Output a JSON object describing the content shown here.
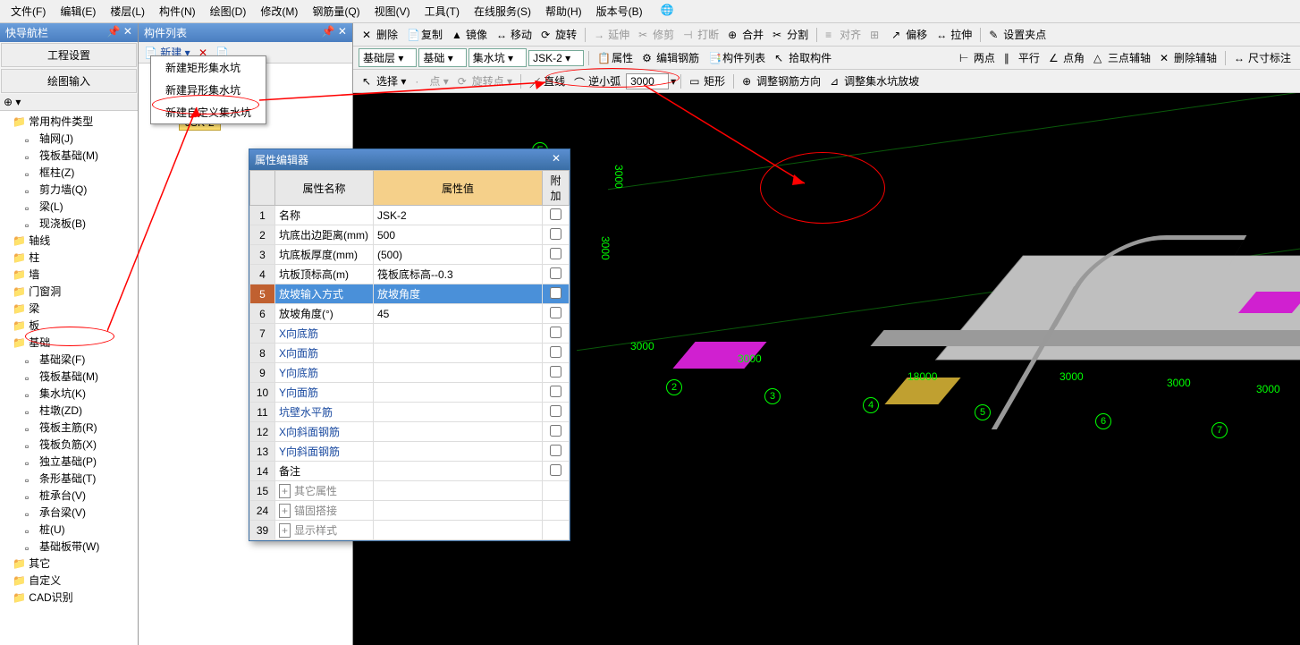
{
  "menu": [
    "文件(F)",
    "编辑(E)",
    "楼层(L)",
    "构件(N)",
    "绘图(D)",
    "修改(M)",
    "钢筋量(Q)",
    "视图(V)",
    "工具(T)",
    "在线服务(S)",
    "帮助(H)",
    "版本号(B)"
  ],
  "nav": {
    "title": "快导航栏",
    "tabs": [
      "工程设置",
      "绘图输入"
    ],
    "toolbar_glyph": "⊕ ▾",
    "tree": [
      {
        "lvl": 1,
        "label": "常用构件类型",
        "folder": true
      },
      {
        "lvl": 2,
        "label": "轴网(J)"
      },
      {
        "lvl": 2,
        "label": "筏板基础(M)"
      },
      {
        "lvl": 2,
        "label": "框柱(Z)"
      },
      {
        "lvl": 2,
        "label": "剪力墙(Q)"
      },
      {
        "lvl": 2,
        "label": "梁(L)"
      },
      {
        "lvl": 2,
        "label": "现浇板(B)"
      },
      {
        "lvl": 1,
        "label": "轴线",
        "folder": true
      },
      {
        "lvl": 1,
        "label": "柱",
        "folder": true
      },
      {
        "lvl": 1,
        "label": "墙",
        "folder": true
      },
      {
        "lvl": 1,
        "label": "门窗洞",
        "folder": true
      },
      {
        "lvl": 1,
        "label": "梁",
        "folder": true
      },
      {
        "lvl": 1,
        "label": "板",
        "folder": true
      },
      {
        "lvl": 1,
        "label": "基础",
        "folder": true
      },
      {
        "lvl": 2,
        "label": "基础梁(F)"
      },
      {
        "lvl": 2,
        "label": "筏板基础(M)"
      },
      {
        "lvl": 2,
        "label": "集水坑(K)",
        "circled": true
      },
      {
        "lvl": 2,
        "label": "柱墩(ZD)"
      },
      {
        "lvl": 2,
        "label": "筏板主筋(R)"
      },
      {
        "lvl": 2,
        "label": "筏板负筋(X)"
      },
      {
        "lvl": 2,
        "label": "独立基础(P)"
      },
      {
        "lvl": 2,
        "label": "条形基础(T)"
      },
      {
        "lvl": 2,
        "label": "桩承台(V)"
      },
      {
        "lvl": 2,
        "label": "承台梁(V)"
      },
      {
        "lvl": 2,
        "label": "桩(U)"
      },
      {
        "lvl": 2,
        "label": "基础板带(W)"
      },
      {
        "lvl": 1,
        "label": "其它",
        "folder": true
      },
      {
        "lvl": 1,
        "label": "自定义",
        "folder": true
      },
      {
        "lvl": 1,
        "label": "CAD识别",
        "folder": true
      }
    ]
  },
  "mid": {
    "title": "构件列表",
    "new_btn": "新建",
    "del_glyph": "✕",
    "copy_glyph": "📄",
    "dropdown": [
      "新建矩形集水坑",
      "新建异形集水坑",
      "新建自定义集水坑"
    ],
    "item": "JSK-2"
  },
  "toolbar1": [
    {
      "label": "删除",
      "icon": "✕"
    },
    {
      "label": "复制",
      "icon": "📄"
    },
    {
      "label": "镜像",
      "icon": "▲"
    },
    {
      "label": "移动",
      "icon": "↔"
    },
    {
      "label": "旋转",
      "icon": "⟳"
    },
    {
      "sep": true
    },
    {
      "label": "延伸",
      "icon": "→",
      "disabled": true
    },
    {
      "label": "修剪",
      "icon": "✂",
      "disabled": true
    },
    {
      "label": "打断",
      "icon": "⊣",
      "disabled": true
    },
    {
      "label": "合并",
      "icon": "⊕"
    },
    {
      "label": "分割",
      "icon": "✂"
    },
    {
      "sep": true
    },
    {
      "label": "对齐",
      "icon": "≡",
      "disabled": true
    },
    {
      "icon": "⊞",
      "disabled": true
    },
    {
      "label": "偏移",
      "icon": "↗"
    },
    {
      "label": "拉伸",
      "icon": "↔"
    },
    {
      "sep": true
    },
    {
      "label": "设置夹点",
      "icon": "✎"
    }
  ],
  "toolbar2": {
    "selects": [
      "基础层",
      "基础",
      "集水坑",
      "JSK-2"
    ],
    "btns": [
      {
        "label": "属性",
        "icon": "📋"
      },
      {
        "label": "编辑钢筋",
        "icon": "⚙"
      },
      {
        "label": "构件列表",
        "icon": "📑"
      },
      {
        "label": "拾取构件",
        "icon": "↖"
      }
    ],
    "right": [
      {
        "label": "两点",
        "icon": "⊢"
      },
      {
        "label": "平行",
        "icon": "∥"
      },
      {
        "label": "点角",
        "icon": "∠"
      },
      {
        "label": "三点辅轴",
        "icon": "△"
      },
      {
        "label": "删除辅轴",
        "icon": "✕"
      },
      {
        "sep": true
      },
      {
        "label": "尺寸标注",
        "icon": "↔"
      }
    ]
  },
  "toolbar3": {
    "left": [
      {
        "label": "选择",
        "icon": "↖"
      },
      {
        "label": "点",
        "icon": "·",
        "disabled": true
      },
      {
        "label": "旋转点",
        "icon": "⟳",
        "disabled": true
      }
    ],
    "mid": [
      {
        "label": "直线",
        "icon": "／"
      },
      {
        "label": "逆小弧",
        "icon": "⌒"
      }
    ],
    "input_value": "3000",
    "right": [
      {
        "label": "矩形",
        "icon": "▭"
      },
      {
        "sep": true
      },
      {
        "label": "调整钢筋方向",
        "icon": "⊕"
      },
      {
        "label": "调整集水坑放坡",
        "icon": "⊿"
      }
    ]
  },
  "dialog": {
    "title": "属性编辑器",
    "headers": [
      "",
      "属性名称",
      "属性值",
      "附加"
    ],
    "rows": [
      {
        "n": "1",
        "name": "名称",
        "val": "JSK-2"
      },
      {
        "n": "2",
        "name": "坑底出边距离(mm)",
        "val": "500"
      },
      {
        "n": "3",
        "name": "坑底板厚度(mm)",
        "val": "(500)"
      },
      {
        "n": "4",
        "name": "坑板顶标高(m)",
        "val": "筏板底标高--0.3"
      },
      {
        "n": "5",
        "name": "放坡输入方式",
        "val": "放坡角度",
        "selected": true
      },
      {
        "n": "6",
        "name": "放坡角度(°)",
        "val": "45"
      },
      {
        "n": "7",
        "name": "X向底筋",
        "val": "",
        "link": true
      },
      {
        "n": "8",
        "name": "X向面筋",
        "val": "",
        "link": true
      },
      {
        "n": "9",
        "name": "Y向底筋",
        "val": "",
        "link": true
      },
      {
        "n": "10",
        "name": "Y向面筋",
        "val": "",
        "link": true
      },
      {
        "n": "11",
        "name": "坑壁水平筋",
        "val": "",
        "link": true
      },
      {
        "n": "12",
        "name": "X向斜面钢筋",
        "val": "",
        "link": true
      },
      {
        "n": "13",
        "name": "Y向斜面钢筋",
        "val": "",
        "link": true
      },
      {
        "n": "14",
        "name": "备注",
        "val": ""
      },
      {
        "n": "15",
        "name": "其它属性",
        "val": "",
        "gray": true,
        "exp": "+"
      },
      {
        "n": "24",
        "name": "锚固搭接",
        "val": "",
        "gray": true,
        "exp": "+"
      },
      {
        "n": "39",
        "name": "显示样式",
        "val": "",
        "gray": true,
        "exp": "+"
      }
    ]
  },
  "viewport": {
    "vdims": [
      "3000",
      "3000"
    ],
    "hdims": [
      "3000",
      "3000",
      "18000",
      "3000",
      "3000",
      "3000"
    ],
    "axes": [
      "2",
      "3",
      "4",
      "5",
      "6",
      "7"
    ],
    "top_axis": "F"
  }
}
